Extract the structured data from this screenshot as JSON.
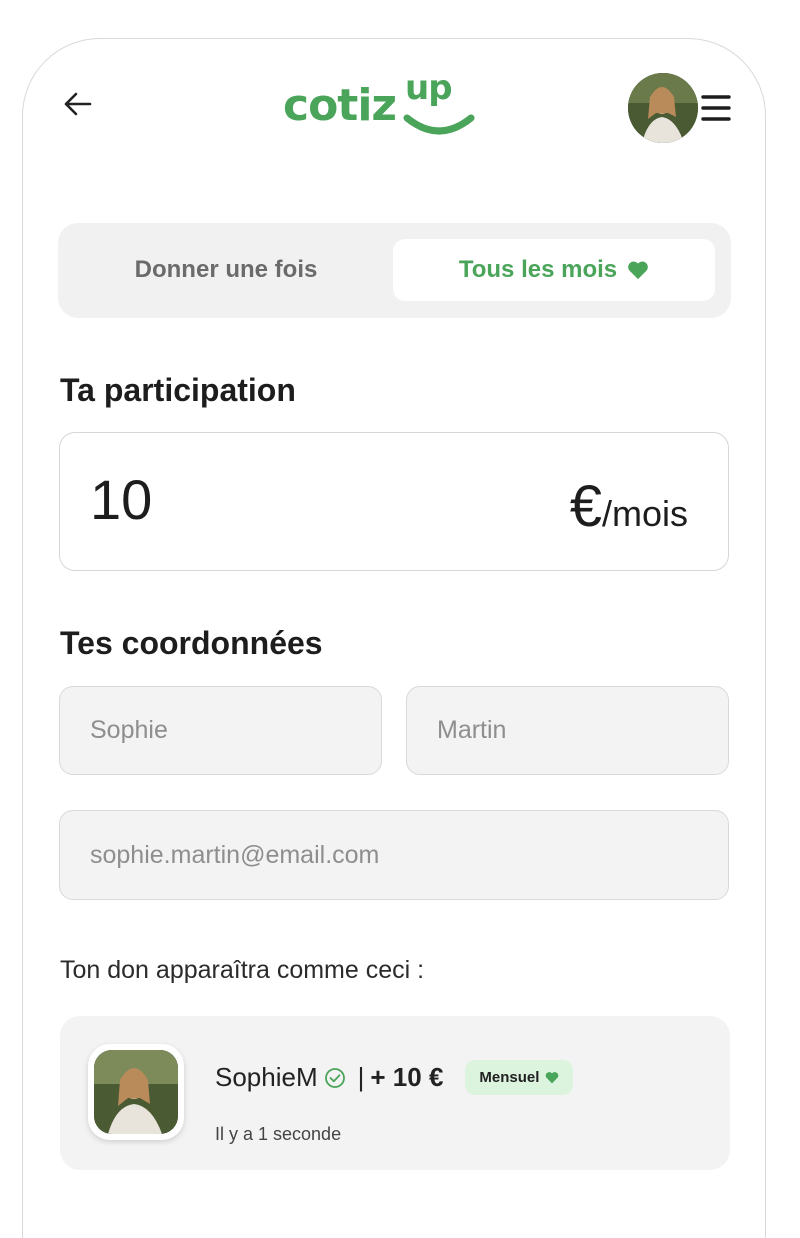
{
  "header": {
    "logo_text": "cotiz",
    "logo_up": "up"
  },
  "toggle": {
    "once_label": "Donner une fois",
    "monthly_label": "Tous les mois",
    "selected": "monthly"
  },
  "participation": {
    "title": "Ta participation",
    "amount": "10",
    "currency": "€",
    "period": "/mois"
  },
  "contact": {
    "title": "Tes coordonnées",
    "first_name_placeholder": "Sophie",
    "last_name_placeholder": "Martin",
    "email_placeholder": "sophie.martin@email.com"
  },
  "preview": {
    "label": "Ton don apparaîtra comme ceci :",
    "name": "SophieM",
    "separator": "|",
    "amount": "+ 10 €",
    "badge": "Mensuel",
    "time": "Il y a 1 seconde"
  },
  "colors": {
    "brand_green": "#4aa45a",
    "badge_bg": "#dcf3de",
    "field_bg": "#f3f3f3"
  }
}
